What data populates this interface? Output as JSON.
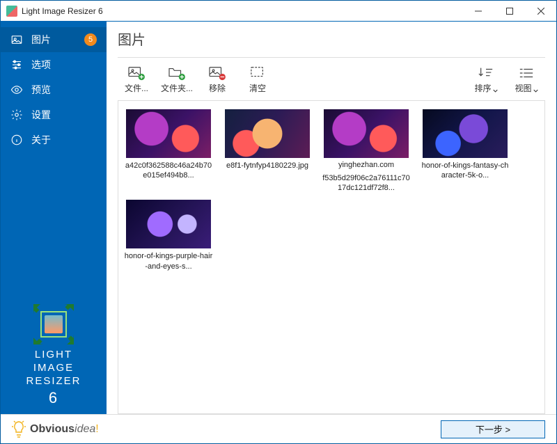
{
  "titlebar": {
    "title": "Light Image Resizer 6"
  },
  "sidebar": {
    "items": [
      {
        "label": "图片",
        "badge": "5"
      },
      {
        "label": "选项"
      },
      {
        "label": "预览"
      },
      {
        "label": "设置"
      },
      {
        "label": "关于"
      }
    ],
    "brand_line1": "LIGHT",
    "brand_line2": "IMAGE",
    "brand_line3": "RESIZER",
    "brand_ver": "6"
  },
  "main": {
    "title": "图片",
    "toolbar": {
      "files": "文件...",
      "folder": "文件夹...",
      "remove": "移除",
      "clear": "清空",
      "sort": "排序",
      "view": "视图"
    },
    "thumbs": [
      {
        "name": "a42c0f362588c46a24b70e015ef494b8...",
        "extra": ""
      },
      {
        "name": "e8f1-fytnfyp4180229.jpg",
        "extra": ""
      },
      {
        "name": "f53b5d29f06c2a76111c7017dc121df72f8...",
        "extra": "yinghezhan.com"
      },
      {
        "name": "honor-of-kings-fantasy-character-5k-o...",
        "extra": ""
      },
      {
        "name": "honor-of-kings-purple-hair-and-eyes-s...",
        "extra": ""
      }
    ]
  },
  "footer": {
    "brand_a": "Obvious",
    "brand_b": "idea",
    "brand_c": "!",
    "next": "下一步 >"
  }
}
